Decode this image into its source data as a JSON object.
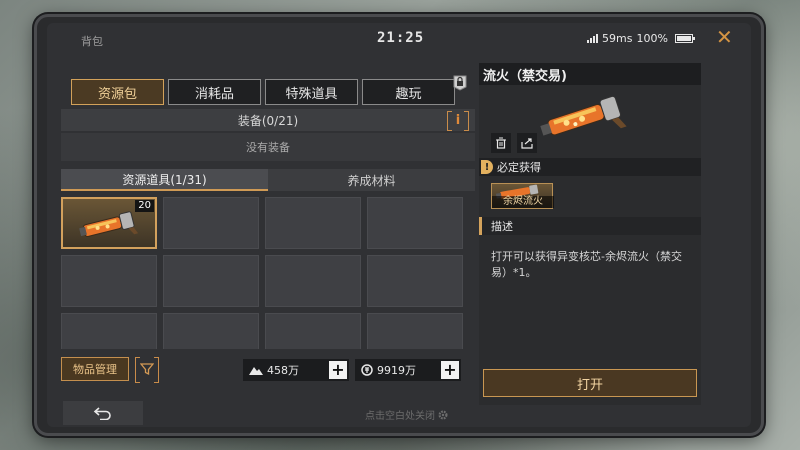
{
  "window": {
    "title": "背包",
    "clock": "21:25",
    "ping": "59ms",
    "battery": "100%",
    "close_icon": "close-icon"
  },
  "tabs": [
    {
      "label": "资源包",
      "active": true
    },
    {
      "label": "消耗品",
      "active": false
    },
    {
      "label": "特殊道具",
      "active": false
    },
    {
      "label": "趣玩",
      "active": false
    }
  ],
  "equipment": {
    "label": "装备(0/21)",
    "info_label": "i",
    "empty_text": "没有装备"
  },
  "subtabs": [
    {
      "label": "资源道具(1/31)",
      "active": true
    },
    {
      "label": "养成材料",
      "active": false
    }
  ],
  "inventory": {
    "items": [
      {
        "name": "余烬流火",
        "count": "20",
        "filled": true
      }
    ],
    "empty_cells": 11
  },
  "footer": {
    "manage_label": "物品管理",
    "filter_icon": "filter-icon",
    "currency1": {
      "value": "458万",
      "icon": "mountain-icon"
    },
    "currency2": {
      "value": "9919万",
      "icon": "coin-icon"
    },
    "plus_label": "+",
    "back_icon": "back-arrow-icon",
    "hint": "点击空白处关闭"
  },
  "detail": {
    "title": "流火（禁交易)",
    "guaranteed_label": "必定获得",
    "reward_name": "余烬流火",
    "desc_label": "描述",
    "description": "打开可以获得异变核芯-余烬流火（禁交易）*1。",
    "open_label": "打开"
  },
  "colors": {
    "accent": "#d2a15a",
    "panel": "#303134",
    "close": "#d49443"
  }
}
